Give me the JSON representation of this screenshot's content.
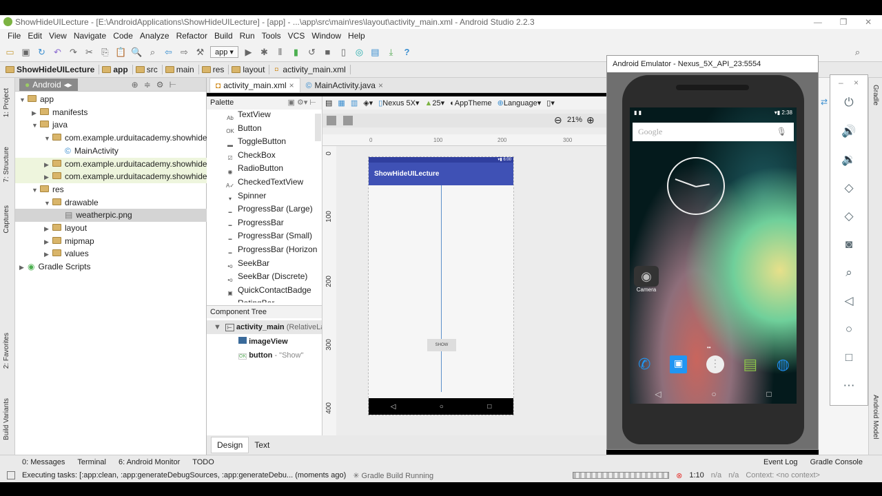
{
  "window": {
    "title": "ShowHideUILecture - [E:\\AndroidApplications\\ShowHideUILecture] - [app] - ...\\app\\src\\main\\res\\layout\\activity_main.xml - Android Studio 2.2.3"
  },
  "menu": [
    "File",
    "Edit",
    "View",
    "Navigate",
    "Code",
    "Analyze",
    "Refactor",
    "Build",
    "Run",
    "Tools",
    "VCS",
    "Window",
    "Help"
  ],
  "toolbar": {
    "run_config": "app ▾"
  },
  "breadcrumb": [
    "ShowHideUILecture",
    "app",
    "src",
    "main",
    "res",
    "layout",
    "activity_main.xml"
  ],
  "left_strip": [
    "1: Project",
    "7: Structure",
    "Captures",
    "2: Favorites",
    "Build Variants"
  ],
  "project": {
    "view": "Android",
    "tree": [
      {
        "label": "app",
        "depth": 0,
        "arrow": "▼",
        "type": "folder"
      },
      {
        "label": "manifests",
        "depth": 1,
        "arrow": "▶",
        "type": "folder"
      },
      {
        "label": "java",
        "depth": 1,
        "arrow": "▼",
        "type": "folder"
      },
      {
        "label": "com.example.urduitacademy.showhideu",
        "depth": 2,
        "arrow": "▼",
        "type": "folder"
      },
      {
        "label": "MainActivity",
        "depth": 3,
        "arrow": "",
        "type": "class"
      },
      {
        "label": "com.example.urduitacademy.showhideu",
        "depth": 2,
        "arrow": "▶",
        "type": "folder"
      },
      {
        "label": "com.example.urduitacademy.showhideu",
        "depth": 2,
        "arrow": "▶",
        "type": "folder"
      },
      {
        "label": "res",
        "depth": 1,
        "arrow": "▼",
        "type": "folder"
      },
      {
        "label": "drawable",
        "depth": 2,
        "arrow": "▼",
        "type": "folder"
      },
      {
        "label": "weatherpic.png",
        "depth": 3,
        "arrow": "",
        "type": "file"
      },
      {
        "label": "layout",
        "depth": 2,
        "arrow": "▶",
        "type": "folder"
      },
      {
        "label": "mipmap",
        "depth": 2,
        "arrow": "▶",
        "type": "folder"
      },
      {
        "label": "values",
        "depth": 2,
        "arrow": "▶",
        "type": "folder"
      },
      {
        "label": "Gradle Scripts",
        "depth": 0,
        "arrow": "▶",
        "type": "gradle"
      }
    ]
  },
  "editor_tabs": [
    "activity_main.xml",
    "MainActivity.java"
  ],
  "palette": {
    "title": "Palette",
    "items": [
      "TextView",
      "Button",
      "ToggleButton",
      "CheckBox",
      "RadioButton",
      "CheckedTextView",
      "Spinner",
      "ProgressBar (Large)",
      "ProgressBar",
      "ProgressBar (Small)",
      "ProgressBar (Horizontal)",
      "SeekBar",
      "SeekBar (Discrete)",
      "QuickContactBadge",
      "RatingBar"
    ],
    "icons": [
      "Ab",
      "OK",
      "▬",
      "☑",
      "◉",
      "A✓",
      "▾",
      "━",
      "━",
      "━",
      "━",
      "•o",
      "•o",
      "▣",
      "★"
    ]
  },
  "component_tree": {
    "title": "Component Tree",
    "root": "activity_main",
    "root_type": "(RelativeLa",
    "children": [
      {
        "name": "imageView",
        "extra": ""
      },
      {
        "name": "button",
        "extra": "- \"Show\""
      }
    ]
  },
  "design_toolbar": {
    "device": "Nexus 5X▾",
    "api": "25▾",
    "theme": "AppTheme",
    "language": "Language▾",
    "zoom": "21%"
  },
  "ruler": [
    "0",
    "100",
    "200",
    "300"
  ],
  "vruler": [
    "0",
    "100",
    "200",
    "300",
    "400"
  ],
  "preview": {
    "status_time": "6:00",
    "app_title": "ShowHideUILecture",
    "button": "SHOW"
  },
  "bottom_tabs": [
    "Design",
    "Text"
  ],
  "tool_windows": [
    "0: Messages",
    "Terminal",
    "6: Android Monitor",
    "TODO"
  ],
  "tool_windows_right": [
    "Event Log",
    "Gradle Console"
  ],
  "status": {
    "message": "Executing tasks: [:app:clean, :app:generateDebugSources, :app:generateDebu... (moments ago)",
    "gradle": "Gradle Build Running",
    "position": "1:10",
    "na1": "n/a",
    "na2": "n/a",
    "context": "Context: <no context>"
  },
  "emulator": {
    "title": "Android Emulator - Nexus_5X_API_23:5554",
    "time": "2:38",
    "search": "Google",
    "app_label": "Camera",
    "controls": [
      "power",
      "volume-up",
      "volume-down",
      "rotate-left",
      "rotate-right",
      "camera",
      "zoom",
      "back",
      "home",
      "overview",
      "more"
    ]
  },
  "right_strip": [
    "Gradle",
    "Android Model"
  ]
}
